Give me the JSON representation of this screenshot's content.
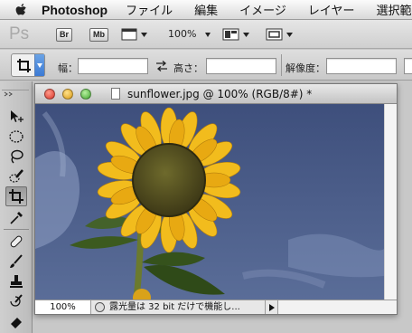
{
  "menubar": {
    "app_name": "Photoshop",
    "items": [
      "ファイル",
      "編集",
      "イメージ",
      "レイヤー",
      "選択範"
    ]
  },
  "appbar": {
    "logo": "Ps",
    "bridge_label": "Br",
    "minibridge_label": "Mb",
    "zoom": "100%"
  },
  "options": {
    "width_label": "幅：",
    "height_label": "高さ：",
    "resolution_label": "解像度：",
    "width_value": "",
    "height_value": "",
    "resolution_value": ""
  },
  "document": {
    "title": "sunflower.jpg @ 100% (RGB/8#) *",
    "zoom": "100%",
    "status_text": "露光量は 32 bit だけで機能し..."
  },
  "colors": {
    "sky": "#4d5f8c",
    "petal": "#f0b91c",
    "seed": "#4f4a1f",
    "leaf": "#3f5a22"
  }
}
